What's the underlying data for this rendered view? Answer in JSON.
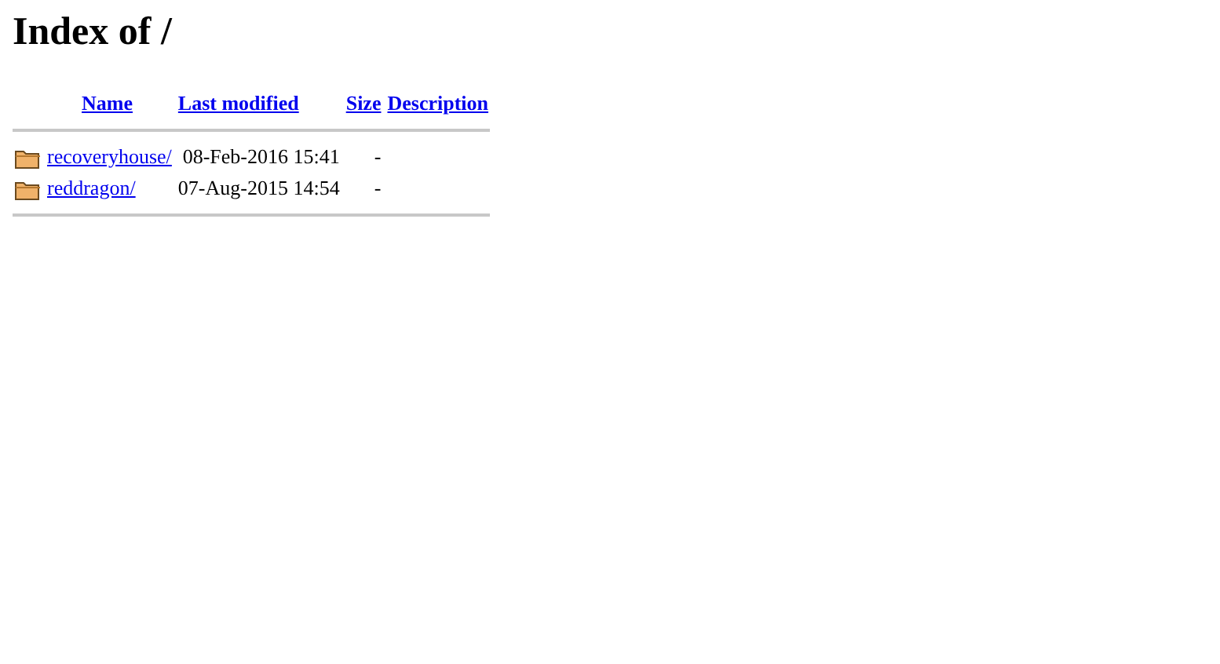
{
  "title": "Index of /",
  "columns": [
    "Name",
    "Last modified",
    "Size",
    "Description"
  ],
  "rows": [
    {
      "kind": "folder",
      "name": "recoveryhouse/",
      "modified": "08-Feb-2016 15:41",
      "size": "-"
    },
    {
      "kind": "folder",
      "name": "reddragon/",
      "modified": "07-Aug-2015 14:54",
      "size": "-"
    }
  ]
}
